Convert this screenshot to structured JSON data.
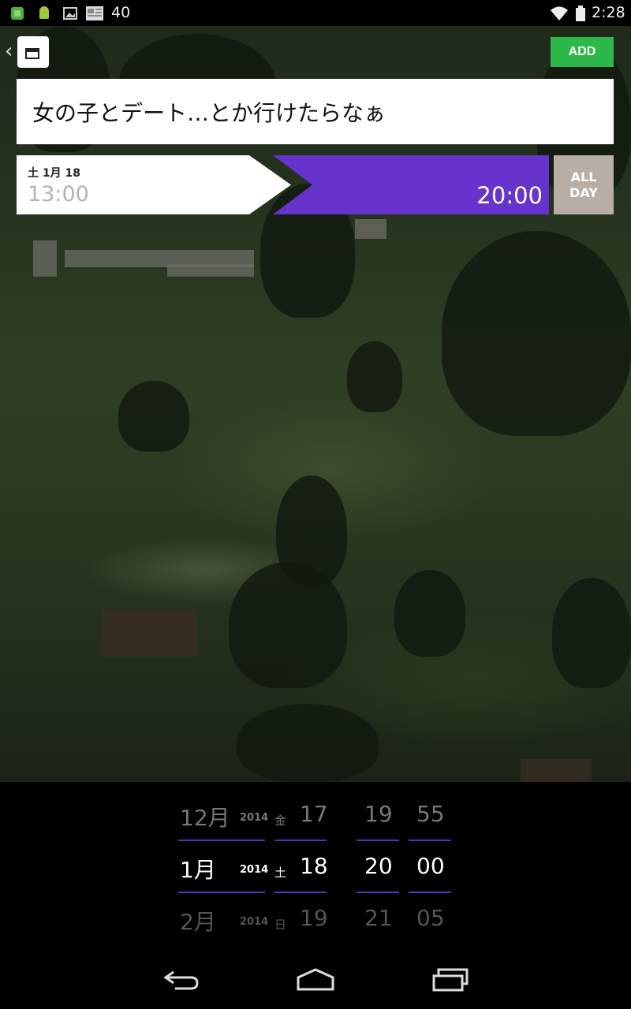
{
  "status_bar": {
    "notification_count": "40",
    "clock": "2:28",
    "icons": [
      "game-notification-icon",
      "android-debug-icon",
      "image-notification-icon",
      "newspaper-notification-icon",
      "wifi-icon",
      "battery-icon"
    ]
  },
  "header": {
    "add_label": "ADD"
  },
  "event": {
    "title": "女の子とデート…とか行けたらなぁ",
    "start_date": "土 1月 18",
    "start_time": "13:00",
    "end_time": "20:00",
    "all_day_line1": "ALL",
    "all_day_line2": "DAY"
  },
  "colors": {
    "accent_purple": "#6633cc",
    "add_green": "#2fb84a",
    "allday_gray": "#b8aea6"
  },
  "picker": {
    "month": {
      "prev": "12月",
      "cur": "1月",
      "next": "2月"
    },
    "year": {
      "prev": "2014",
      "cur": "2014",
      "next": "2014"
    },
    "weekday": {
      "prev": "金",
      "cur": "土",
      "next": "日"
    },
    "day": {
      "prev": "17",
      "cur": "18",
      "next": "19"
    },
    "hour": {
      "prev": "19",
      "cur": "20",
      "next": "21"
    },
    "minute": {
      "prev": "55",
      "cur": "00",
      "next": "05"
    }
  },
  "nav_bar": {
    "icons": [
      "back-icon",
      "home-icon",
      "recent-apps-icon"
    ]
  }
}
